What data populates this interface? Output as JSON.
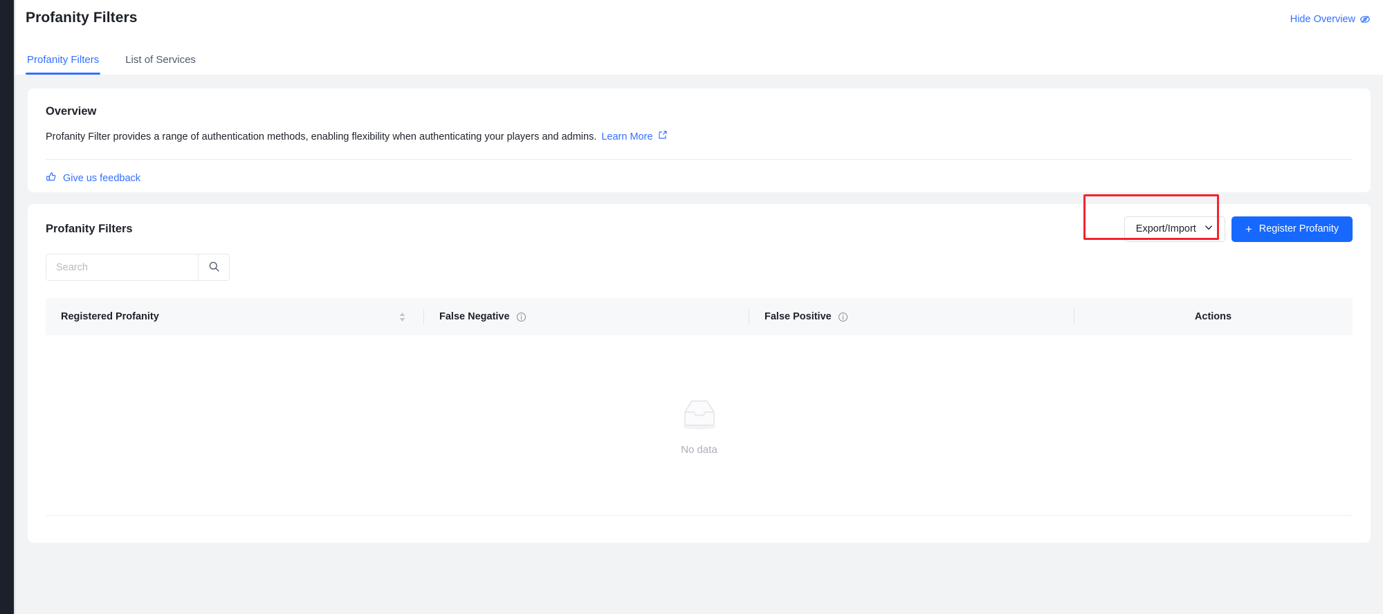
{
  "window": {
    "accent_color": "#3370ff",
    "primary_button_color": "#1668ff",
    "annotation_color": "#f5222d",
    "page_background": "#f2f3f5",
    "rail_color": "#1b212b"
  },
  "header": {
    "title": "Profanity Filters",
    "hide_overview_label": "Hide Overview",
    "hide_overview_icon": "eye-slash-icon",
    "tabs": [
      {
        "label": "Profanity Filters",
        "active": true
      },
      {
        "label": "List of Services",
        "active": false
      }
    ]
  },
  "overview": {
    "title": "Overview",
    "description": "Profanity Filter provides a range of authentication methods, enabling flexibility when authenticating your players and admins.",
    "learn_more_label": "Learn More",
    "learn_more_icon": "external-link-icon",
    "feedback_label": "Give us feedback",
    "feedback_icon": "thumbs-up-icon"
  },
  "filters": {
    "title": "Profanity Filters",
    "export_import_label": "Export/Import",
    "export_import_icon": "chevron-down-icon",
    "register_label": "Register Profanity",
    "register_icon": "plus-icon",
    "search": {
      "placeholder": "Search",
      "value": "",
      "icon": "search-icon"
    },
    "table": {
      "columns": [
        {
          "label": "Registered Profanity",
          "sortable": true,
          "sort_icon": "sort-arrows-icon"
        },
        {
          "label": "False Negative",
          "info_icon": "info-circle-icon"
        },
        {
          "label": "False Positive",
          "info_icon": "info-circle-icon"
        },
        {
          "label": "Actions"
        }
      ],
      "rows": [],
      "empty_text": "No data",
      "empty_icon": "empty-inbox-icon"
    }
  }
}
